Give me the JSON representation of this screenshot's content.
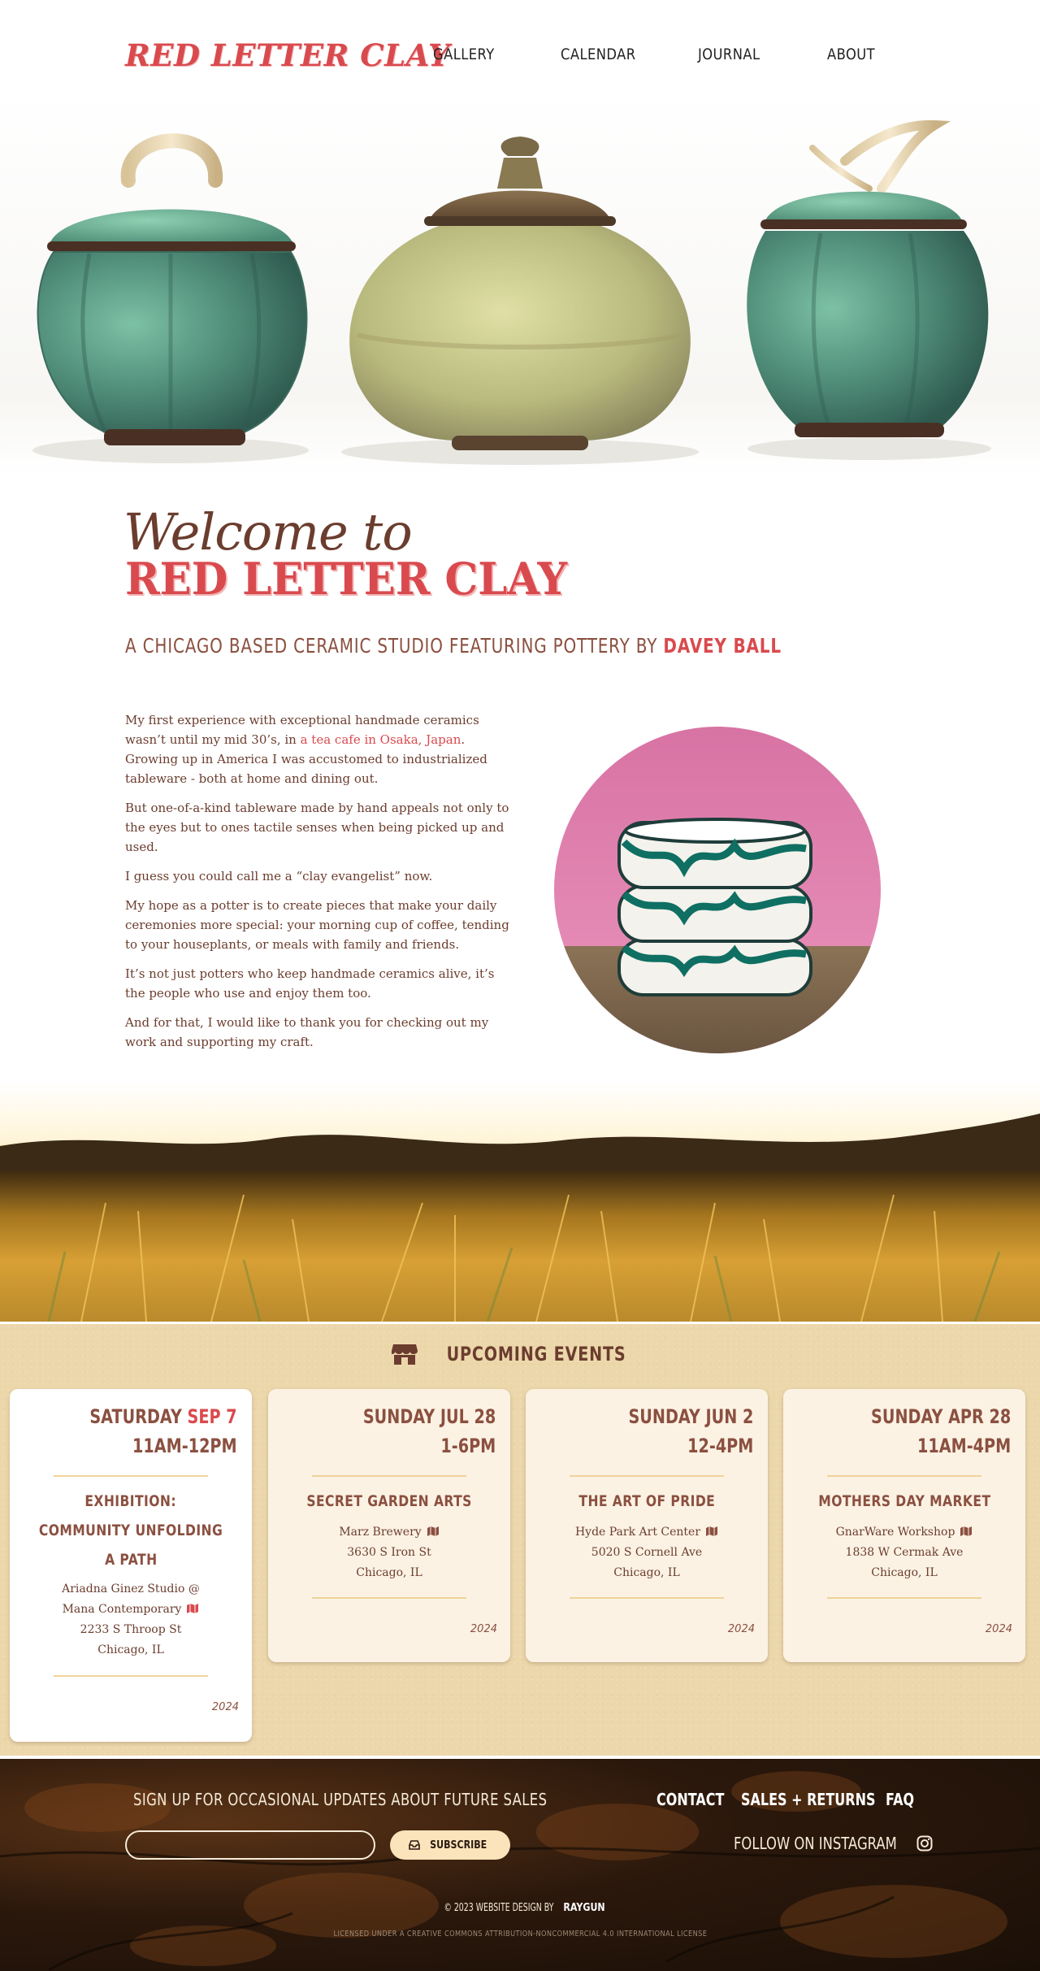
{
  "header": {
    "logo": "RED LETTER CLAY",
    "nav": [
      "GALLERY",
      "CALENDAR",
      "JOURNAL",
      "ABOUT"
    ]
  },
  "welcome": {
    "script": "Welcome to",
    "brand": "RED LETTER CLAY",
    "tagline_prefix": "A CHICAGO BASED CERAMIC STUDIO FEATURING POTTERY BY ",
    "tagline_accent": "DAVEY BALL"
  },
  "intro": {
    "p1_before": "My first experience with exceptional handmade ceramics wasn’t until my mid 30’s, in ",
    "p1_link": "a tea cafe in Osaka, Japan",
    "p1_after": ". Growing up in America I was accustomed to industrialized tableware - both at home and dining out.",
    "p2": "But one-of-a-kind tableware made by hand appeals not only to the eyes but to ones tactile senses when being picked up and used.",
    "p3": "I guess you could call me a “clay evangelist” now.",
    "p4": "My hope as a potter is to create pieces that make your daily ceremonies more special: your morning cup of coffee, tending to your houseplants, or meals with family and friends.",
    "p5": "It’s not just potters who keep handmade ceramics alive, it’s the people who use and enjoy them too.",
    "p6": "And for that, I would like to thank you for checking out my work and supporting my craft."
  },
  "events": {
    "title": "UPCOMING EVENTS",
    "cards": [
      {
        "day": "SATURDAY ",
        "date": "SEP 7",
        "time": "11AM-12PM",
        "name_lines": [
          "EXHIBITION:",
          "COMMUNITY UNFOLDING",
          "A PATH"
        ],
        "venue_lines": [
          "Ariadna Ginez Studio @",
          "Mana Contemporary",
          "2233 S Throop St",
          "Chicago, IL"
        ],
        "year": "2024"
      },
      {
        "day": "SUNDAY JUL 28",
        "time": "1-6PM",
        "name": "SECRET GARDEN ARTS",
        "venue": "Marz Brewery",
        "address": "3630 S Iron St",
        "city": "Chicago, IL",
        "year": "2024"
      },
      {
        "day": "SUNDAY JUN 2",
        "time": "12-4PM",
        "name": "THE ART OF PRIDE",
        "venue": "Hyde Park Art Center",
        "address": "5020 S Cornell Ave",
        "city": "Chicago, IL",
        "year": "2024"
      },
      {
        "day": "SUNDAY APR 28",
        "time": "11AM-4PM",
        "name": "MOTHERS DAY MARKET",
        "venue": "GnarWare Workshop",
        "address": "1838 W Cermak Ave",
        "city": "Chicago, IL",
        "year": "2024"
      }
    ]
  },
  "footer": {
    "signup_label": "SIGN UP FOR OCCASIONAL UPDATES ABOUT FUTURE SALES",
    "email_value": "",
    "subscribe_label": "SUBSCRIBE",
    "links": [
      "CONTACT",
      "SALES + RETURNS",
      "FAQ"
    ],
    "follow": "FOLLOW ON INSTAGRAM",
    "copyright_prefix": "© 2023 WEBSITE DESIGN BY ",
    "copyright_brand": "RAYGUN",
    "license": "LICENSED UNDER A CREATIVE COMMONS ATTRIBUTION-NONCOMMERCIAL 4.0 INTERNATIONAL LICENSE"
  },
  "colors": {
    "brand_red": "#d94a4e",
    "brown": "#6b3d2e",
    "events_bg": "#ecd7ab",
    "subscribe_bg": "#fbe3bb"
  }
}
